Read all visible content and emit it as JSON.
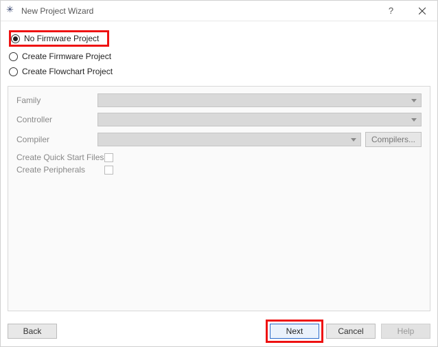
{
  "window": {
    "title": "New Project Wizard"
  },
  "radios": {
    "no_firmware": "No Firmware Project",
    "create_firmware": "Create Firmware Project",
    "create_flowchart": "Create Flowchart Project"
  },
  "form": {
    "family_label": "Family",
    "controller_label": "Controller",
    "compiler_label": "Compiler",
    "compilers_btn": "Compilers...",
    "quick_start_label": "Create Quick Start Files",
    "peripherals_label": "Create Peripherals"
  },
  "footer": {
    "back": "Back",
    "next": "Next",
    "cancel": "Cancel",
    "help": "Help"
  }
}
